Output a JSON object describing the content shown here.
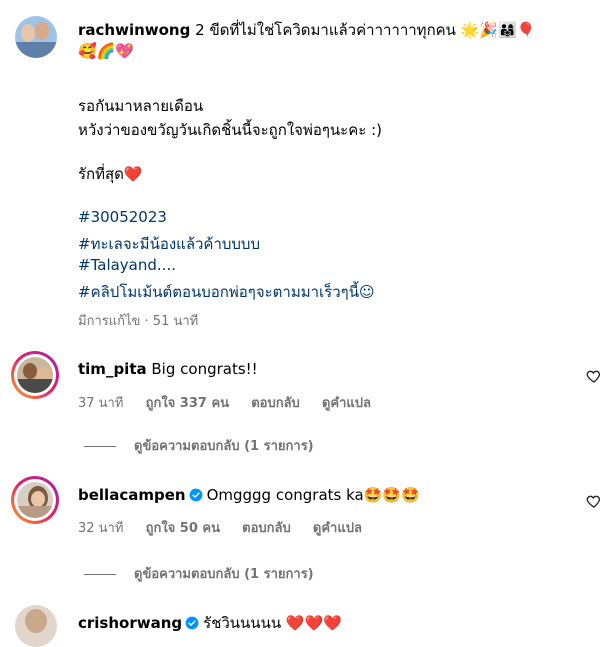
{
  "caption": {
    "username": "rachwinwong",
    "line1": " 2 ขีดที่ไม่ใช่โควิดมาแล้วค่าาาาาาทุกคน 🌟🎉👨‍👩‍👧🎈",
    "line2": "🥰🌈💖",
    "line3": "รอกันมาหลายเดือน",
    "line4": "หวังว่าของขวัญวันเกิดชิ้นนี้จะถูกใจพ่อๆนะคะ :)",
    "line5": "รักที่สุด❤️",
    "hashtags": [
      "#30052023",
      "#ทะเลจะมีน้องแล้วค้าบบบบ",
      "#Talayand....",
      "#คลิปโมเม้นต์ตอนบอกพ่อๆจะตามมาเร็วๆนี้☺"
    ],
    "meta": "มีการแก้ไข · 51 นาที"
  },
  "comments": [
    {
      "username": "tim_pita",
      "text": " Big congrats!!",
      "time": "37 นาที",
      "likes": "ถูกใจ 337 คน",
      "reply": "ตอบกลับ",
      "translate": "ดูคำแปล",
      "view_replies": "ดูข้อความตอบกลับ (1 รายการ)"
    },
    {
      "username": "bellacampen",
      "text": "Omgggg congrats ka🤩🤩🤩",
      "time": "32 นาที",
      "likes": "ถูกใจ 50 คน",
      "reply": "ตอบกลับ",
      "translate": "ดูคำแปล",
      "view_replies": "ดูข้อความตอบกลับ (1 รายการ)"
    },
    {
      "username": "crishorwang",
      "text": "รัชวินนนนน ❤️❤️❤️"
    }
  ],
  "colors": {
    "link": "#00376b",
    "muted": "#737373",
    "verified": "#0095f6"
  }
}
